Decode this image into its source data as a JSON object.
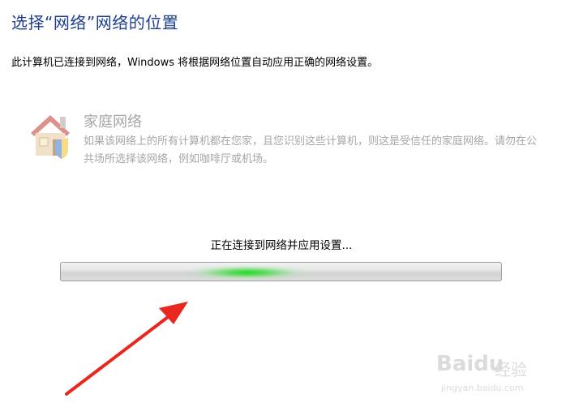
{
  "header": {
    "title": "选择“网络”网络的位置",
    "description": "此计算机已连接到网络，Windows 将根据网络位置自动应用正确的网络设置。"
  },
  "network_option": {
    "icon": "home-network-icon",
    "title": "家庭网络",
    "description": "如果该网络上的所有计算机都在您家，且您识别这些计算机，则这是受信任的家庭网络。请勿在公共场所选择该网络，例如咖啡厅或机场。"
  },
  "progress": {
    "status": "正在连接到网络并应用设置...",
    "indeterminate": true,
    "glow_color": "#22d922"
  },
  "annotation": {
    "arrow_color": "#e8271f"
  },
  "watermark": {
    "brand": "Baidu",
    "name": "经验",
    "url": "jingyan.baidu.com"
  }
}
